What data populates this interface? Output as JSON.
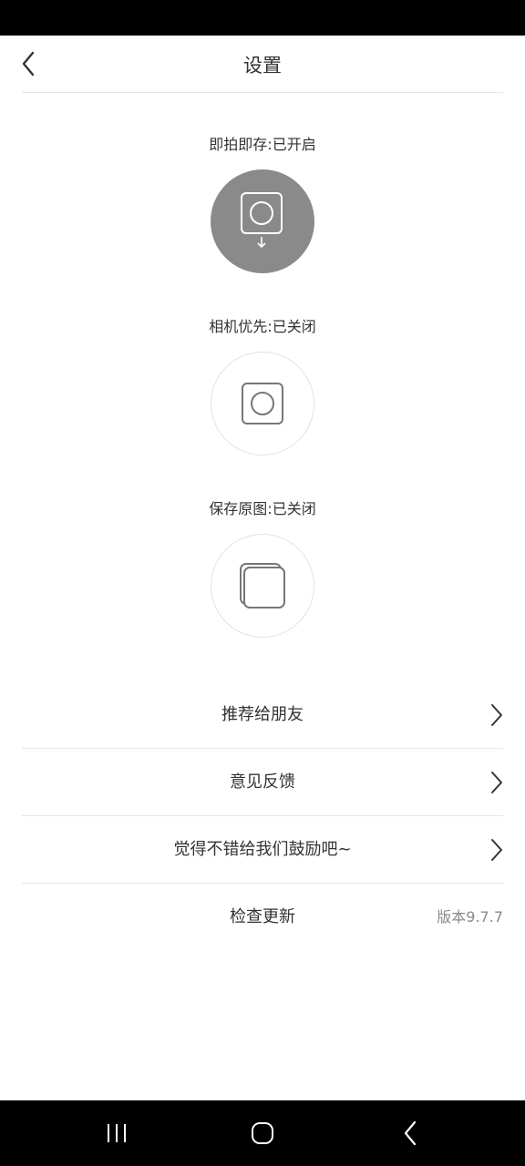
{
  "header": {
    "title": "设置",
    "back_icon": "chevron-left-icon"
  },
  "toggles": [
    {
      "label": "即拍即存:已开启",
      "state": "on",
      "icon": "instant-save-icon"
    },
    {
      "label": "相机优先:已关闭",
      "state": "off",
      "icon": "camera-priority-icon"
    },
    {
      "label": "保存原图:已关闭",
      "state": "off",
      "icon": "original-image-icon"
    }
  ],
  "menu": [
    {
      "label": "推荐给朋友",
      "icon": "chevron-right-icon"
    },
    {
      "label": "意见反馈",
      "icon": "chevron-right-icon"
    },
    {
      "label": "觉得不错给我们鼓励吧~",
      "icon": "chevron-right-icon"
    },
    {
      "label": "检查更新",
      "value": "版本9.7.7"
    }
  ],
  "nav": {
    "recents_icon": "recents-icon",
    "home_icon": "home-icon",
    "back_icon": "back-icon"
  },
  "colors": {
    "toggle_on_bg": "#8a8a8a",
    "toggle_off_border": "#e2e2e2",
    "divider": "#e6e6e6",
    "text": "#333333",
    "secondary_text": "#8a8a8a"
  }
}
